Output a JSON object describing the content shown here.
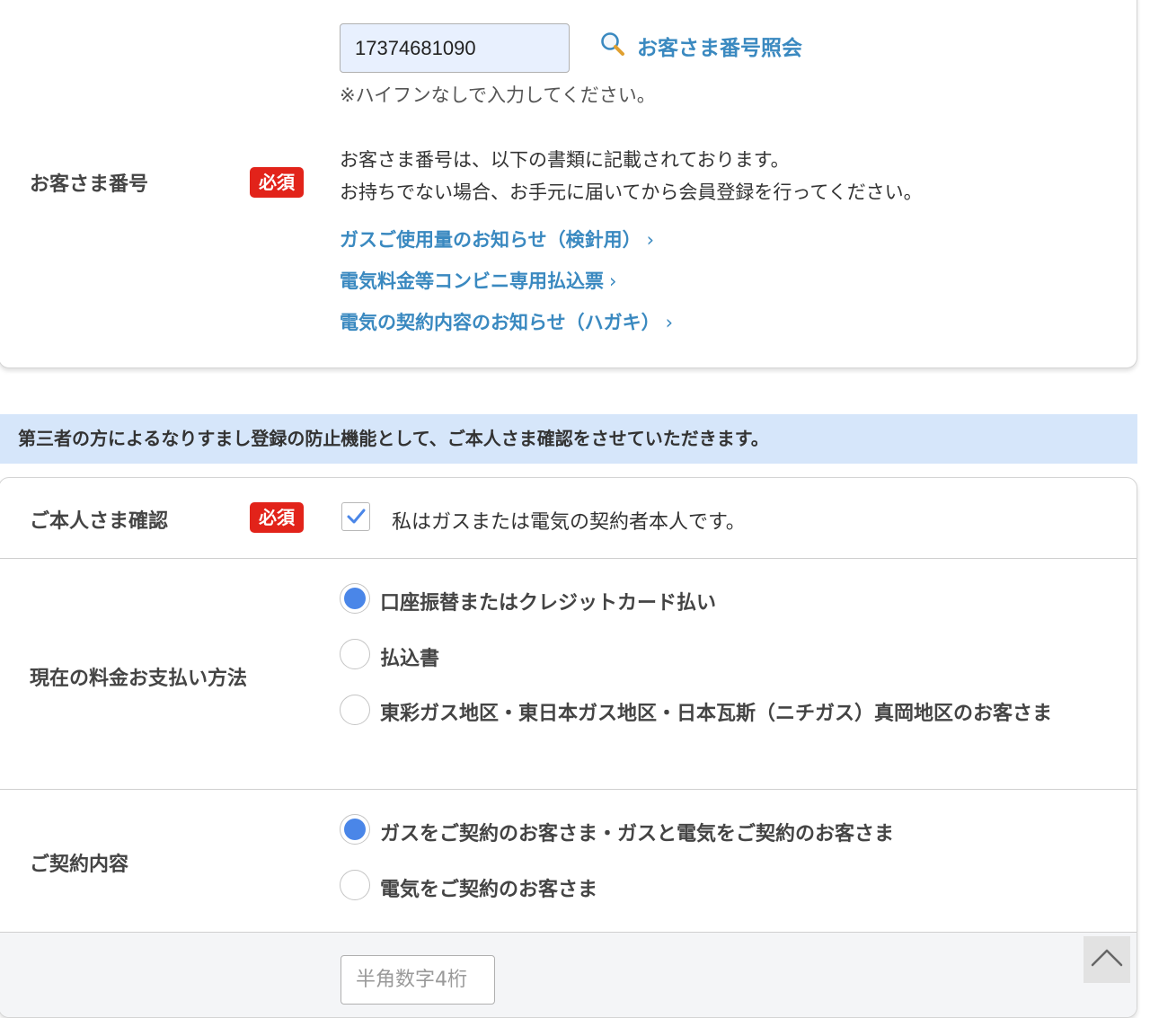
{
  "customer": {
    "label": "お客さま番号",
    "required": "必須",
    "input_value": "17374681090",
    "lookup_label": "お客さま番号照会",
    "note": "※ハイフンなしで入力してください。",
    "desc_line1": "お客さま番号は、以下の書類に記載されております。",
    "desc_line2": "お持ちでない場合、お手元に届いてから会員登録を行ってください。",
    "links": [
      "ガスご使用量のお知らせ（検針用）",
      "電気料金等コンビニ専用払込票",
      "電気の契約内容のお知らせ（ハガキ）"
    ],
    "chevron": "›"
  },
  "notice": "第三者の方によるなりすまし登録の防止機能として、ご本人さま確認をさせていただきます。",
  "identity": {
    "label": "ご本人さま確認",
    "required": "必須",
    "checkbox_checked": true,
    "checkbox_text": "私はガスまたは電気の契約者本人です。"
  },
  "payment": {
    "label": "現在の料金お支払い方法",
    "options": [
      "口座振替またはクレジットカード払い",
      "払込書",
      "東彩ガス地区・東日本ガス地区・日本瓦斯（ニチガス）真岡地区のお客さま"
    ],
    "selected": 0
  },
  "contract": {
    "label": "ご契約内容",
    "options": [
      "ガスをご契約のお客さま・ガスと電気をご契約のお客さま",
      "電気をご契約のお客さま"
    ],
    "selected": 0
  },
  "pin": {
    "placeholder": "半角数字4桁"
  },
  "colors": {
    "accent": "#4a86e8",
    "link": "#3a89c0",
    "required": "#e2231a",
    "notice_bg": "#d6e6fa"
  }
}
